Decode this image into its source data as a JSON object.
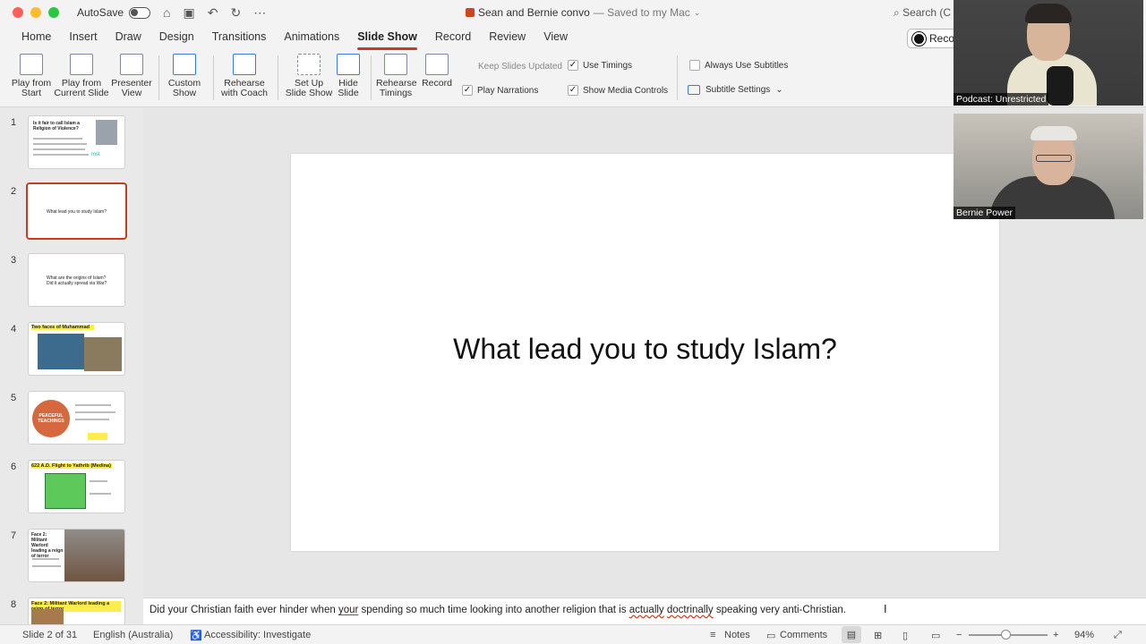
{
  "titlebar": {
    "autosave_label": "AutoSave",
    "doc_title": "Sean and Bernie convo",
    "saved_status": "— Saved to my Mac",
    "search_label": "Search (C"
  },
  "tabs": [
    "Home",
    "Insert",
    "Draw",
    "Design",
    "Transitions",
    "Animations",
    "Slide Show",
    "Record",
    "Review",
    "View"
  ],
  "active_tab": "Slide Show",
  "record_button": "Reco",
  "ribbon": {
    "play_from_start": "Play from\nStart",
    "play_current": "Play from\nCurrent Slide",
    "presenter_view": "Presenter\nView",
    "custom_show": "Custom\nShow",
    "rehearse_coach": "Rehearse\nwith Coach",
    "setup_show": "Set Up\nSlide Show",
    "hide_slide": "Hide\nSlide",
    "rehearse_timings": "Rehearse\nTimings",
    "record": "Record",
    "keep_updated": "Keep Slides Updated",
    "use_timings": "Use Timings",
    "play_narrations": "Play Narrations",
    "show_media": "Show Media Controls",
    "always_subtitles": "Always Use Subtitles",
    "subtitle_settings": "Subtitle Settings"
  },
  "thumbnails": [
    {
      "num": "1",
      "title": "Is it fair to call Islam a Religion of Violence?"
    },
    {
      "num": "2",
      "title": "What lead you to study Islam?"
    },
    {
      "num": "3",
      "title": "What are the origins of Islam? Did it actually spread via War?"
    },
    {
      "num": "4",
      "title": "Two faces of Muhammad"
    },
    {
      "num": "5",
      "title": "PEACEFUL TEACHINGS"
    },
    {
      "num": "6",
      "title": "622 A.D. Flight to Yathrib (Medina)"
    },
    {
      "num": "7",
      "title": "Face 2: Militant Warlord leading a reign of terror"
    },
    {
      "num": "8",
      "title": "Face 2: Militant Warlord leading a reign of terror"
    }
  ],
  "slide": {
    "title": "What lead you to study Islam?"
  },
  "notes": {
    "part1": "Did your Christian faith ever hinder when ",
    "your": "your",
    "part2": " spending so much time looking into another religion that is ",
    "actually": "actually",
    "part3": " ",
    "doctrinally": "doctrinally",
    "part4": " speaking very anti-Christian."
  },
  "status": {
    "slide_pos": "Slide 2 of 31",
    "language": "English (Australia)",
    "accessibility": "Accessibility: Investigate",
    "notes": "Notes",
    "comments": "Comments",
    "zoom": "94%"
  },
  "video": {
    "tile1_label": "Podcast: Unrestricted",
    "tile2_label": "Bernie Power"
  },
  "colors": {
    "accent": "#c43e1c",
    "slide_bg": "#ffffff"
  }
}
